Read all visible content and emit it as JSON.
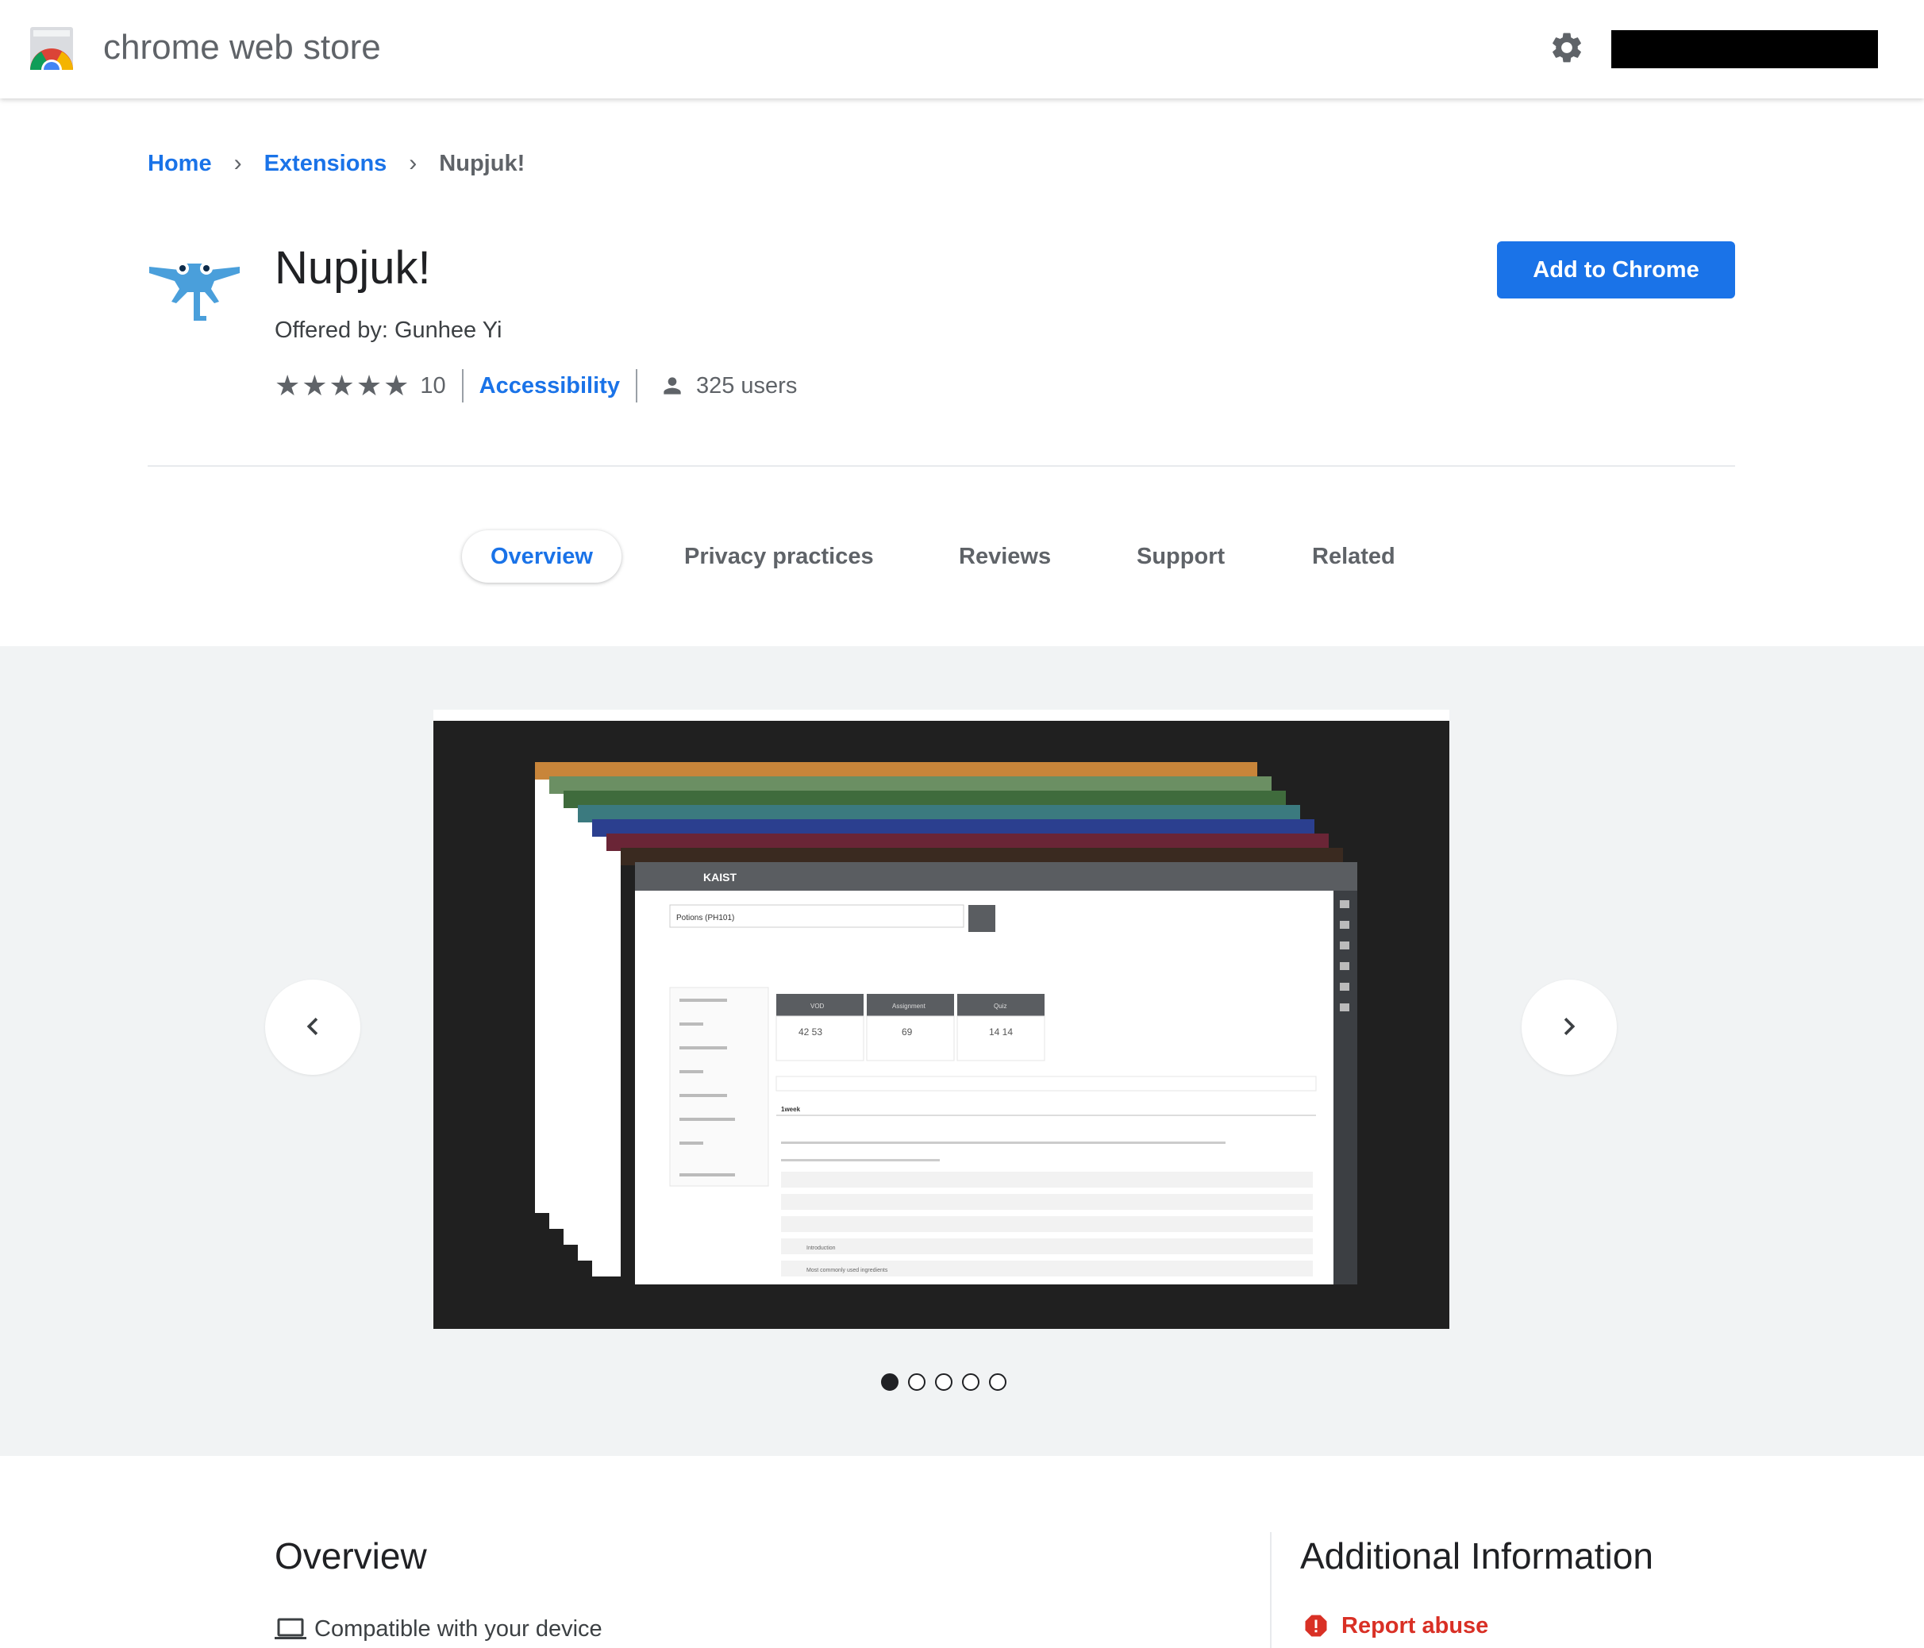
{
  "header": {
    "store_name": "chrome web store"
  },
  "breadcrumb": {
    "home": "Home",
    "extensions": "Extensions",
    "current": "Nupjuk!",
    "separator": "›"
  },
  "item": {
    "title": "Nupjuk!",
    "offered_by": "Offered by: Gunhee Yi",
    "rating_stars": "★★★★★",
    "rating_value": 5,
    "rating_count": "10",
    "category": "Accessibility",
    "users": "325 users",
    "add_button": "Add to Chrome"
  },
  "tabs": [
    {
      "label": "Overview",
      "active": true
    },
    {
      "label": "Privacy practices",
      "active": false
    },
    {
      "label": "Reviews",
      "active": false
    },
    {
      "label": "Support",
      "active": false
    },
    {
      "label": "Related",
      "active": false
    }
  ],
  "gallery": {
    "slide_count": 5,
    "current_slide": 1,
    "screenshot": {
      "brand": "KAIST",
      "course": "Potions (PH101)",
      "stat_headers": [
        "VOD",
        "Assignment",
        "Quiz"
      ],
      "stat_values": [
        "42 53",
        "69",
        "14 14"
      ],
      "week_label": "1week",
      "items": [
        "Introduction",
        "Most commonly used ingredients"
      ]
    }
  },
  "overview": {
    "heading": "Overview",
    "compat": "Compatible with your device"
  },
  "additional": {
    "heading": "Additional Information",
    "report": "Report abuse"
  },
  "colors": {
    "accent": "#1a73e8",
    "danger": "#d93025",
    "gallery_bg": "#f1f3f4"
  },
  "icons": [
    "chrome-web-store-logo-icon",
    "gear-icon",
    "nupjuk-icon",
    "star-icon",
    "user-icon",
    "chevron-left-icon",
    "chevron-right-icon",
    "laptop-icon",
    "alert-icon"
  ]
}
